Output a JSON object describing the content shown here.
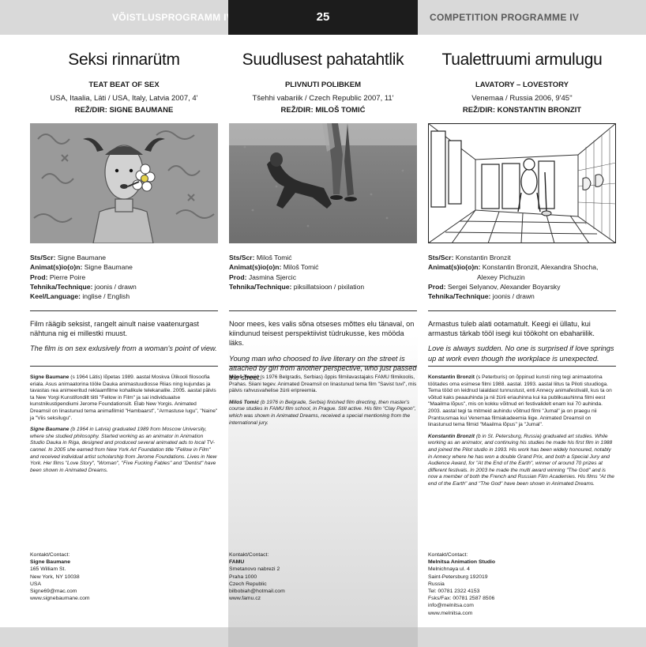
{
  "header": {
    "left": "VÕISTLUSPROGRAMM IV",
    "page": "25",
    "right": "COMPETITION PROGRAMME IV"
  },
  "films": [
    {
      "title": "Seksi rinnarütm",
      "original_title": "TEAT BEAT OF SEX",
      "country_year": "USA, Itaalia, Läti / USA, Italy, Latvia 2007, 4'",
      "director": "REŽ/DIR: SIGNE BAUMANE",
      "credits": [
        {
          "label": "Sts/Scr:",
          "value": " Signe Baumane"
        },
        {
          "label": "Animat(s)io(o)n:",
          "value": " Signe Baumane"
        },
        {
          "label": "Prod:",
          "value": " Pierre Poire"
        },
        {
          "label": "Tehnika/Technique:",
          "value": " joonis / drawn"
        },
        {
          "label": "Keel/Language:",
          "value": " inglise / English"
        }
      ],
      "synopsis_et": "Film räägib seksist, rangelt ainult naise vaatenurgast nähtuna nig ei millestki muust.",
      "synopsis_en": "The film is on sex exlusively from a woman's point of view.",
      "bio_et_name": "Signe Baumane",
      "bio_et": " (s 1964 Lätis) lõpetas 1989. aastal Moskva Ülikooli filosoofia eriala. Asus animaatorina tööle Dauka animastuudiosse Riias ning kujundas ja tavastas rea animeeritud reklaamfilme kohalikule telekanalile. 2005. aastal pälvis ta New Yorgi Kunstifondilt tiitli \"Fellow in Film\" ja sai individuaalse kunstnikustipendiumi Jerome Foundationsilt. Elab New Yorgis. Animated Dreamsil on linastunud tema animafilmid \"Hambaarst\", \"Armastuse lugu\", \"Naine\" ja \"Viis seksilugu\".",
      "bio_en_name": "Signe Baumane",
      "bio_en": " (b 1964 in Latvia) graduated 1989 from Moscow University, where she studied philosophy. Started working as an animator in Animation Studio Dauka in Riga, designed and produced several animated ads to local TV-cannel. In 2005 she earned from New York Art Foundation title \"Fellow in Film\" and received individual artist scholarship from Jerome Foundations. Lives in New York. Her films \"Love Story\", \"Woman\", \"Five Fucking Fables\" and \"Dentist\" have been shown in Animated Dreams.",
      "contact": {
        "heading": "Kontakt/Contact:",
        "name": "Signe Baumane",
        "lines": [
          "165 William St.",
          "New York, NY 10038",
          "USA",
          "Signe69@mac.com",
          "www.signebaumane.com"
        ]
      }
    },
    {
      "title": "Suudlusest pahatahtlik",
      "original_title": "PLIVNUTI POLIBKEM",
      "country_year": "Tšehhi vabariik / Czech Republic 2007, 11'",
      "director": "REŽ/DIR: MILOŠ TOMIĆ",
      "credits": [
        {
          "label": "Sts/Scr:",
          "value": " Miloš Tomić"
        },
        {
          "label": "Animat(s)io(o)n:",
          "value": " Miloš Tomić"
        },
        {
          "label": "Prod:",
          "value": " Jasmina Sjercic"
        },
        {
          "label": "Tehnika/Technique:",
          "value": " piksillatsioon / pixilation"
        }
      ],
      "synopsis_et": "Noor mees, kes valis sõna otseses mõttes elu tänaval, on kiindunud teisest perspektiivist tüdrukusse, kes mööda läks.",
      "synopsis_en": "Young man who choosed to live literary on the street is attached by girl from another perspective, who just passed the street.",
      "bio_et_name": "Miloš Tomić",
      "bio_et": " (s 1976 Belgradis, Serbias) õppis filmilavastajaks FAMU filmikoolis, Prahas. Siiani tegev. Animated Dreamsil on linastunud tema film \"Savist tuvi\", mis pälvis rahvusvahelise žürii eripreemia.",
      "bio_en_name": "Miloš Tomić",
      "bio_en": " (b 1976 in Belgrade, Serbia) finished film directing, then master's course studies in FAMU film school, in Prague. Still active. His film \"Clay Pigeon\", which was shown in Animated Dreams, received a special mentioning from the international jury.",
      "contact": {
        "heading": "Kontakt/Contact:",
        "name": "FAMU",
        "lines": [
          "Smetanovo nabrezi 2",
          "Praha 1000",
          "Czech Republic",
          "bilbobiah@hotmail.com",
          "www.famu.cz"
        ]
      }
    },
    {
      "title": "Tualettruumi armulugu",
      "original_title": "LAVATORY – LOVESTORY",
      "country_year": "Venemaa / Russia 2006, 9'45''",
      "director": "REŽ/DIR: KONSTANTIN BRONZIT",
      "credits": [
        {
          "label": "Sts/Scr:",
          "value": " Konstantin Bronzit"
        },
        {
          "label": "Animat(s)io(o)n:",
          "value": " Konstantin Bronzit, Alexandra Shocha,"
        },
        {
          "label": "",
          "value": "Alexey Pichuzin"
        },
        {
          "label": "Prod:",
          "value": " Sergei Selyanov, Alexander Boyarsky"
        },
        {
          "label": "Tehnika/Technique:",
          "value": " joonis / drawn"
        }
      ],
      "synopsis_et": "Armastus tuleb alati ootamatult. Keegi ei üllatu, kui armastus tärkab tööl isegi kui töökoht on ebahariilik.",
      "synopsis_en": "Love is always sudden. No one is surprised if love springs up at work even though the workplace is unexpected.",
      "bio_et_name": "Konstantin Bronzit",
      "bio_et": " (s Peterburis) on õppinud kunsti ning tegi animaatorina töötades oma esimese filmi 1988. aastal. 1993. aastal liitus ta Piloti stuudioga. Tema tööd on leidnud laialdast tunnustust, enti Annecy animafestivalil, kus ta on võitud kaks peaauhinda ja nii žürii eriauhinna kui ka publikuauhinna filmi eest \"Maailma lõpus\", mis on kokku võitnud eri festivalidelt enam kui 70 auhinda. 2003. aastal tegi ta mitmeid auhindu võitnud filmi \"Jumal\" ja on praegu nii Prantsusmaa kui Venemaa filmiakadeemia liige. Animated Dreamsil on linastunud tema filmid \"Maailma lõpus\" ja \"Jumal\".",
      "bio_en_name": "Konstantin Bronzit",
      "bio_en": " (b in St. Petersburg, Russia) graduated art studies. While working as an animator, and continuing his studies he made his first film in 1988 and joined the Pilot studio in 1993. His work has been widely honoured, notably in Annecy where he has won a double Grand Prix, and both a Special Jury and Audience Award, for \"At the End of the Earth\", winner of around 70 prizes at different festivals. In 2003 he made the multi award winning \"The God\" and is now a member of both the French and Russian Film Academies. His films \"At the end of the Earth\" and \"The God\" have been shown in Animated Dreams.",
      "contact": {
        "heading": "Kontakt/Contact:",
        "name": "Melnitsa Animation Studio",
        "lines": [
          "Melnichnaya ul. 4",
          "Saint-Petersburg 192019",
          "Russia",
          "Tel: 00781 2322 4153",
          "Fsks/Fax: 00781 2587 8506",
          "info@melnitsa.com",
          "www.melnitsa.com"
        ]
      }
    }
  ]
}
